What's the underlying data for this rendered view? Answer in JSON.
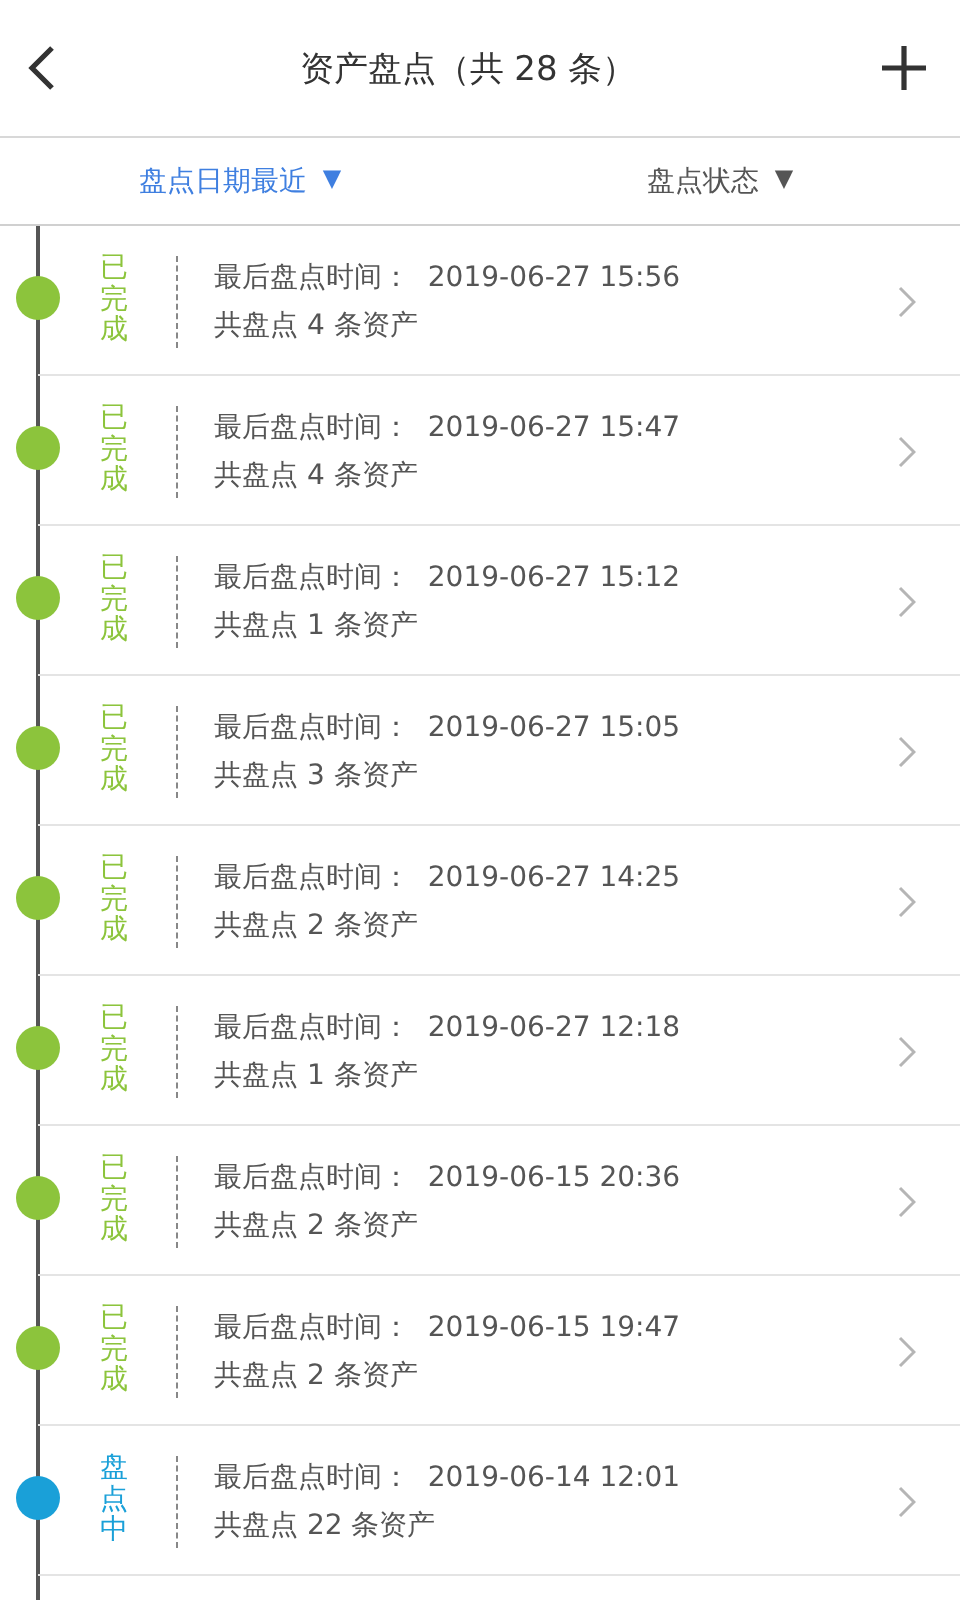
{
  "header": {
    "title": "资产盘点（共 28 条）"
  },
  "filters": [
    {
      "label": "盘点日期最近",
      "caret": "▼",
      "selected": true
    },
    {
      "label": "盘点状态",
      "caret": "▼",
      "selected": false
    }
  ],
  "records": [
    {
      "status": "已完成",
      "color": "#8cc43c",
      "last_time": "最后盘点时间：  2019-06-27 15:56",
      "count": "共盘点 4 条资产"
    },
    {
      "status": "已完成",
      "color": "#8cc43c",
      "last_time": "最后盘点时间：  2019-06-27 15:47",
      "count": "共盘点 4 条资产"
    },
    {
      "status": "已完成",
      "color": "#8cc43c",
      "last_time": "最后盘点时间：  2019-06-27 15:12",
      "count": "共盘点 1 条资产"
    },
    {
      "status": "已完成",
      "color": "#8cc43c",
      "last_time": "最后盘点时间：  2019-06-27 15:05",
      "count": "共盘点 3 条资产"
    },
    {
      "status": "已完成",
      "color": "#8cc43c",
      "last_time": "最后盘点时间：  2019-06-27 14:25",
      "count": "共盘点 2 条资产"
    },
    {
      "status": "已完成",
      "color": "#8cc43c",
      "last_time": "最后盘点时间：  2019-06-27 12:18",
      "count": "共盘点 1 条资产"
    },
    {
      "status": "已完成",
      "color": "#8cc43c",
      "last_time": "最后盘点时间：  2019-06-15 20:36",
      "count": "共盘点 2 条资产"
    },
    {
      "status": "已完成",
      "color": "#8cc43c",
      "last_time": "最后盘点时间：  2019-06-15 19:47",
      "count": "共盘点 2 条资产"
    },
    {
      "status": "盘点中",
      "color": "#1aa0d8",
      "last_time": "最后盘点时间：  2019-06-14 12:01",
      "count": "共盘点 22 条资产"
    }
  ]
}
